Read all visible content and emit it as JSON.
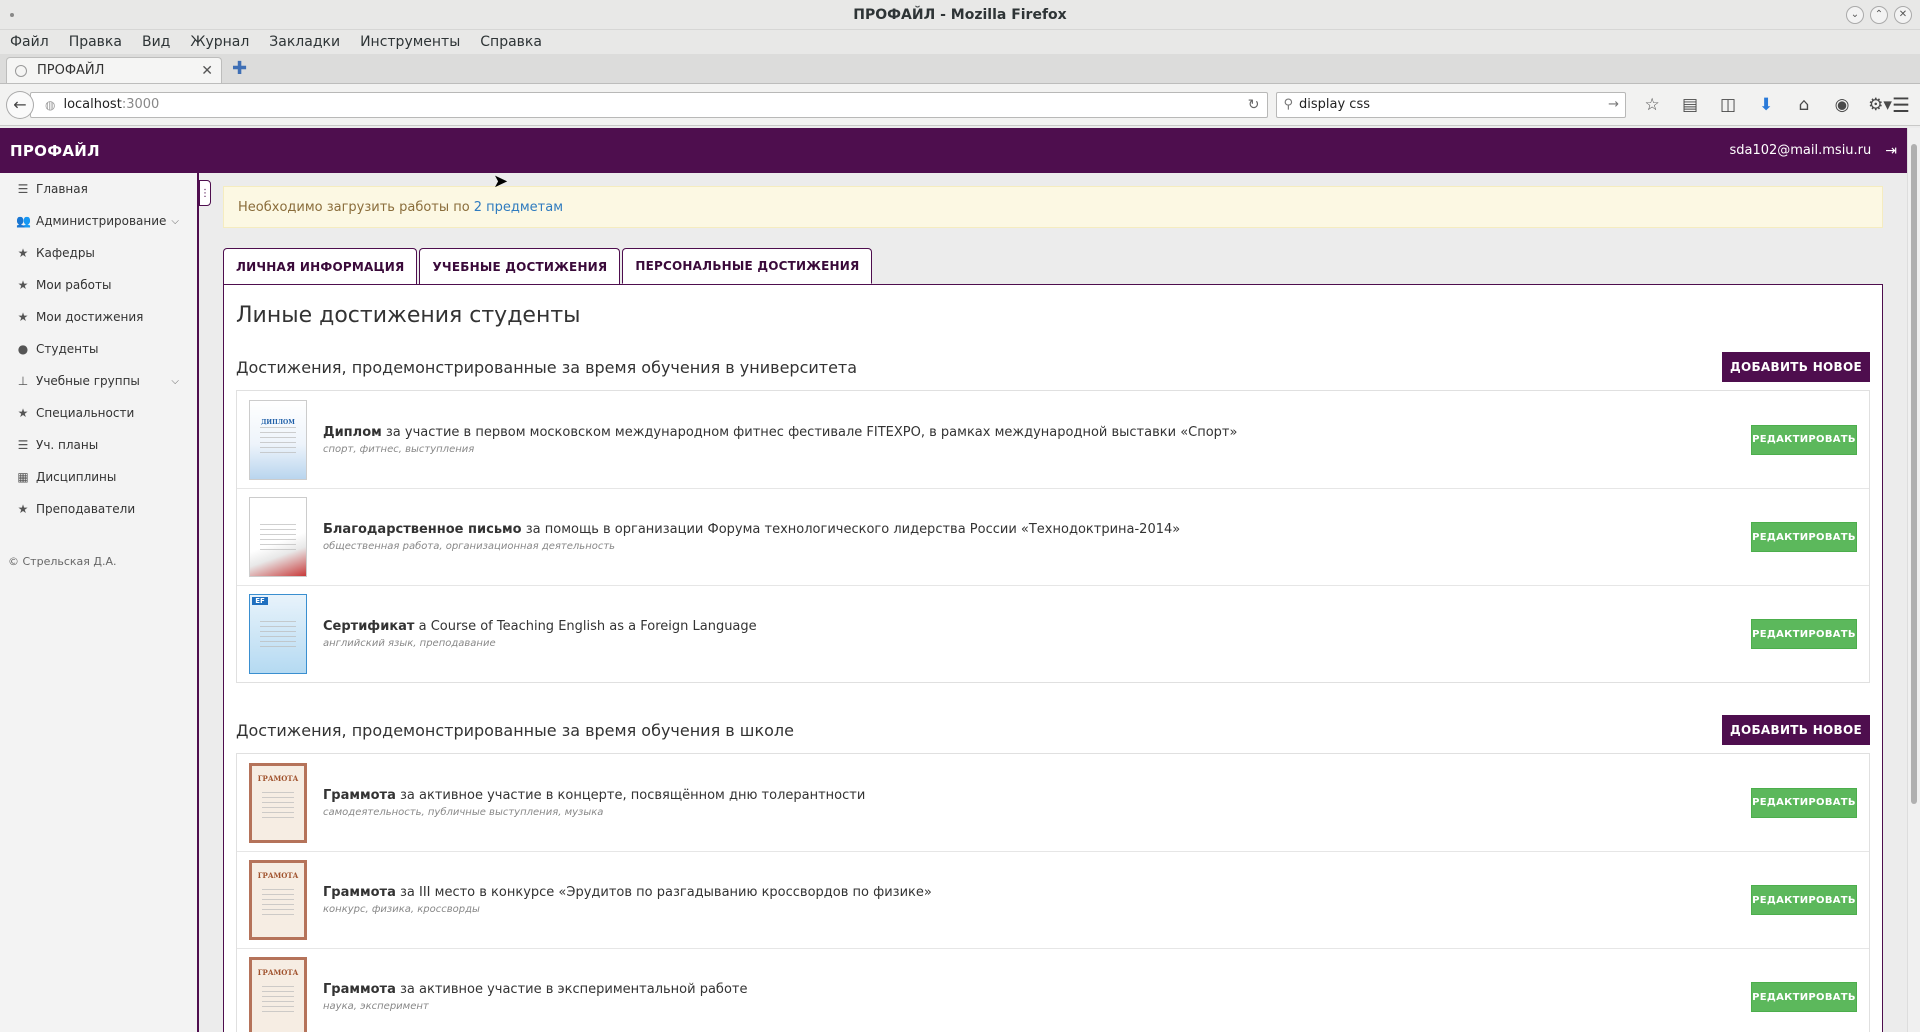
{
  "window": {
    "title": "ПРОФАЙЛ - Mozilla Firefox"
  },
  "menu": [
    "Файл",
    "Правка",
    "Вид",
    "Журнал",
    "Закладки",
    "Инструменты",
    "Справка"
  ],
  "browser_tab": {
    "title": "ПРОФАЙЛ"
  },
  "navbar": {
    "url_host": "localhost",
    "url_port": ":3000",
    "search_value": "display css"
  },
  "app": {
    "brand": "ПРОФАЙЛ",
    "user_email": "sda102@mail.msiu.ru"
  },
  "sidebar": {
    "items": [
      {
        "label": "Главная",
        "icon": "list-icon"
      },
      {
        "label": "Администрирование",
        "icon": "users-icon",
        "has_submenu": true
      },
      {
        "label": "Кафедры",
        "icon": "star-icon"
      },
      {
        "label": "Мои работы",
        "icon": "star-icon"
      },
      {
        "label": "Мои достижения",
        "icon": "star-icon"
      },
      {
        "label": "Студенты",
        "icon": "user-icon"
      },
      {
        "label": "Учебные группы",
        "icon": "sitemap-icon",
        "has_submenu": true
      },
      {
        "label": "Специальности",
        "icon": "star-icon"
      },
      {
        "label": "Уч. планы",
        "icon": "list-icon"
      },
      {
        "label": "Дисциплины",
        "icon": "grid-icon"
      },
      {
        "label": "Преподаватели",
        "icon": "star-icon"
      }
    ],
    "copyright": "© Стрельская Д.А."
  },
  "alert": {
    "text": "Необходимо загрузить работы по",
    "link": "2 предметам"
  },
  "tabs": [
    {
      "label": "ЛИЧНАЯ ИНФОРМАЦИЯ"
    },
    {
      "label": "УЧЕБНЫЕ ДОСТИЖЕНИЯ"
    },
    {
      "label": "ПЕРСОНАЛЬНЫЕ ДОСТИЖЕНИЯ",
      "active": true
    }
  ],
  "panel": {
    "title": "Линые достижения студенты",
    "add_label": "ДОБАВИТЬ НОВОЕ",
    "edit_label": "РЕДАКТИРОВАТЬ",
    "sections": [
      {
        "title": "Достижения, продемонстрированные за время обучения в университета",
        "items": [
          {
            "type": "Диплом",
            "text": "за участие в первом московском международном фитнес фестивале FITEXPO, в рамках международной выставки «Спорт»",
            "tags": "спорт, фитнес, выступления",
            "thumb": "diploma"
          },
          {
            "type": "Благодарственное письмо",
            "text": "за помощь в организации Форума технологического лидерства России «Технодоктрина-2014»",
            "tags": "общественная работа, организационная деятельность",
            "thumb": "letter"
          },
          {
            "type": "Сертификат",
            "text": "a Course of Teaching English as a Foreign Language",
            "tags": "английский язык, преподавание",
            "thumb": "cert"
          }
        ]
      },
      {
        "title": "Достижения, продемонстрированные за время обучения в школе",
        "items": [
          {
            "type": "Граммота",
            "text": "за активное участие в концерте, посвящённом дню толерантности",
            "tags": "самодеятельность, публичные выступления, музыка",
            "thumb": "gramota"
          },
          {
            "type": "Граммота",
            "text": "за III место в конкурсе «Эрудитов по разгадыванию кроссвордов по физике»",
            "tags": "конкурс, физика, кроссворды",
            "thumb": "gramota"
          },
          {
            "type": "Граммота",
            "text": "за активное участие в экспериментальной работе",
            "tags": "наука, эксперимент",
            "thumb": "gramota"
          }
        ]
      }
    ]
  },
  "thumb_labels": {
    "diploma": "ДИПЛОМ",
    "letter": "",
    "cert": "EF",
    "gramota": "ГРАМОТА"
  },
  "colors": {
    "brand": "#4e0e4e",
    "edit_button": "#5cb85c",
    "alert_bg": "#fcf8e3",
    "link": "#2f7bbf"
  }
}
